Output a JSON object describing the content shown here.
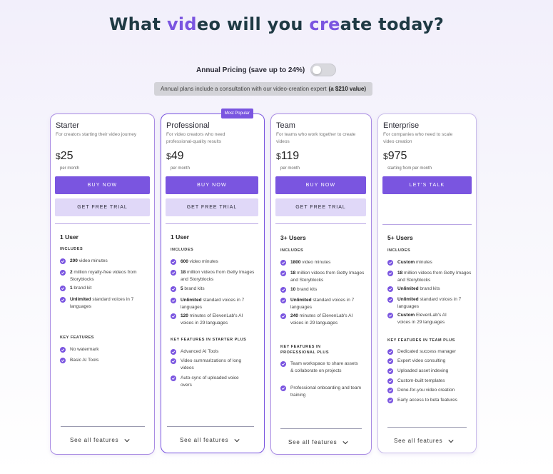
{
  "headline": {
    "part1": "What ",
    "part2": "vid",
    "part3": "eo will you ",
    "part4": "cre",
    "part5": "ate today?"
  },
  "pricing_toggle": {
    "label": "Annual Pricing (save up to 24%)",
    "enabled": false
  },
  "note": {
    "text": "Annual plans include a consultation with our video-creation expert",
    "bold": "(a $210 value)"
  },
  "plans": [
    {
      "name": "Starter",
      "description": "For creators starting their video journey",
      "currency": "$",
      "price": "25",
      "per": "per month",
      "buy_label": "BUY NOW",
      "trial_label": "GET FREE TRIAL",
      "users": "1 User",
      "includes_title": "INCLUDES",
      "includes": [
        {
          "bold": "200",
          "text": " video minutes"
        },
        {
          "bold": "2",
          "text": " million royalty-free videos from Storyblocks"
        },
        {
          "bold": "1",
          "text": " brand kit"
        },
        {
          "bold": "Unlimited",
          "text": " standard voices in 7 languages"
        }
      ],
      "features_title": "KEY FEATURES",
      "features": [
        "No watermark",
        "Basic AI Tools"
      ],
      "see_all": "See all features"
    },
    {
      "name": "Professional",
      "badge": "Most Popular",
      "description": "For video creators who need professional-quality results",
      "currency": "$",
      "price": "49",
      "per": "per month",
      "buy_label": "BUY NOW",
      "trial_label": "GET FREE TRIAL",
      "users": "1 User",
      "includes_title": "INCLUDES",
      "includes": [
        {
          "bold": "600",
          "text": " video minutes"
        },
        {
          "bold": "18",
          "text": " million videos from Getty Images and Storyblocks"
        },
        {
          "bold": "5",
          "text": " brand kits"
        },
        {
          "bold": "Unlimited",
          "text": " standard voices in 7 languages"
        },
        {
          "bold": "120",
          "text": " minutes of ElevenLab's AI voices in 29 languages"
        }
      ],
      "features_title": "KEY FEATURES IN STARTER PLUS",
      "features": [
        "Advanced AI Tools",
        "Video summarizations of long videos",
        "Auto-sync of uploaded voice overs"
      ],
      "see_all": "See all features"
    },
    {
      "name": "Team",
      "description": "For teams who work together to create videos",
      "currency": "$",
      "price": "119",
      "per": "per month",
      "buy_label": "BUY NOW",
      "trial_label": "GET FREE TRIAL",
      "users": "3+ Users",
      "includes_title": "INCLUDES",
      "includes": [
        {
          "bold": "1800",
          "text": " video minutes"
        },
        {
          "bold": "18",
          "text": " million videos from Getty Images and Storyblocks"
        },
        {
          "bold": "10",
          "text": " brand kits"
        },
        {
          "bold": "Unlimited",
          "text": " standard voices in 7 languages"
        },
        {
          "bold": "240",
          "text": " minutes of ElevenLab's AI voices in 29 languages"
        }
      ],
      "features_title": "KEY FEATURES IN PROFESSIONAL PLUS",
      "features": [
        "Team workspace to share assets & collaborate on projects",
        "Professional onboarding and team training"
      ],
      "see_all": "See all features"
    },
    {
      "name": "Enterprise",
      "description": "For companies who need  to scale video creation",
      "currency": "$",
      "price": "975",
      "per": "starting from per month",
      "buy_label": "LET'S TALK",
      "users": "5+ Users",
      "includes_title": "INCLUDES",
      "includes": [
        {
          "bold": "Custom",
          "text": " minutes"
        },
        {
          "bold": "18",
          "text": " million videos from Getty Images and Storyblocks"
        },
        {
          "bold": "Unlimited",
          "text": " brand kits"
        },
        {
          "bold": "Unlimited",
          "text": " standard voices in 7 languages"
        },
        {
          "bold": "Custom",
          "text": " ElevenLab's AI voices in 29 languages"
        }
      ],
      "features_title": "KEY FEATURES IN TEAM PLUS",
      "features": [
        "Dedicated success manager",
        "Expert video consulting",
        "Uploaded asset indexing",
        "Custom-built templates",
        "Done-for-you video creation",
        "Early access to beta features"
      ],
      "see_all": "See all features"
    }
  ],
  "colors": {
    "accent": "#7a55e0",
    "accent_light": "#e0d8f8",
    "headline": "#1f3a44"
  },
  "icons": {
    "check": "check-circle-icon",
    "chevron": "chevron-down-icon"
  }
}
